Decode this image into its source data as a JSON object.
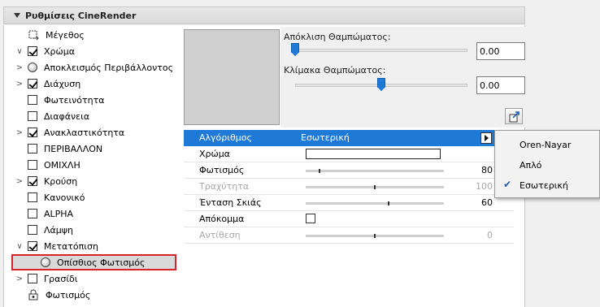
{
  "header": {
    "title": "Ρυθμίσεις CineRender"
  },
  "tree": [
    {
      "chev": "",
      "mark": "size",
      "label": "Μέγεθος"
    },
    {
      "chev": "∨",
      "mark": "checked",
      "label": "Χρώμα"
    },
    {
      "chev": ">",
      "mark": "sphere",
      "label": "Αποκλεισμός Περιβάλλοντος"
    },
    {
      "chev": ">",
      "mark": "checked",
      "label": "Διάχυση"
    },
    {
      "chev": "",
      "mark": "unchecked",
      "label": "Φωτεινότητα"
    },
    {
      "chev": "",
      "mark": "unchecked",
      "label": "Διαφάνεια"
    },
    {
      "chev": ">",
      "mark": "checked",
      "label": "Ανακλαστικότητα"
    },
    {
      "chev": "",
      "mark": "unchecked",
      "label": "ΠΕΡΙΒΑΛΛΟΝ"
    },
    {
      "chev": "",
      "mark": "unchecked",
      "label": "ΟΜΙΧΛΗ"
    },
    {
      "chev": ">",
      "mark": "checked",
      "label": "Κρούση"
    },
    {
      "chev": "",
      "mark": "unchecked",
      "label": "Κανονικό"
    },
    {
      "chev": "",
      "mark": "unchecked",
      "label": "ALPHA"
    },
    {
      "chev": "",
      "mark": "unchecked",
      "label": "Λάμψη"
    },
    {
      "chev": "∨",
      "mark": "checked",
      "label": "Μετατόπιση"
    },
    {
      "chev": "",
      "mark": "sphere",
      "label": "Οπίσθιος Φωτισμός"
    },
    {
      "chev": ">",
      "mark": "unchecked",
      "label": "Γρασίδι"
    },
    {
      "chev": "",
      "mark": "lock",
      "label": "Φωτισμός"
    }
  ],
  "controls": {
    "blur_offset_label": "Απόκλιση Θαμπώματος:",
    "blur_offset_value": "0.00",
    "blur_offset_level": 0,
    "blur_scale_label": "Κλίμακα Θαμπώματος:",
    "blur_scale_value": "0.00",
    "blur_scale_level": 0.5
  },
  "properties": {
    "algorithm_label": "Αλγόριθμος",
    "algorithm_value": "Εσωτερική",
    "color_label": "Χρώμα",
    "lighting_label": "Φωτισμός",
    "lighting_value": "80",
    "lighting_level": 0.1,
    "roughness_label": "Τραχύτητα",
    "roughness_value": "100",
    "roughness_level": 0.5,
    "shadow_label": "Ένταση Σκιάς",
    "shadow_value": "60",
    "shadow_level": 0.6,
    "clipping_label": "Απόκομμα",
    "contrast_label": "Αντίθεση",
    "contrast_value": "0",
    "contrast_level": 0.5
  },
  "popup": {
    "items": [
      "Oren-Nayar",
      "Απλό",
      "Εσωτερική"
    ],
    "selected_index": 2
  }
}
